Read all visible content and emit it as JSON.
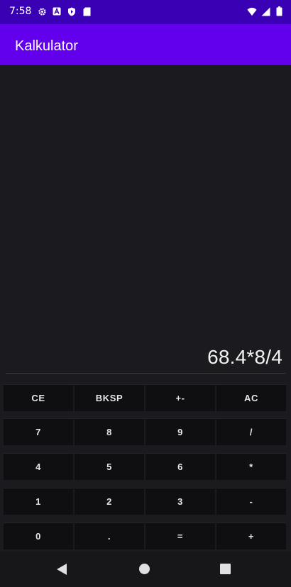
{
  "status_bar": {
    "time": "7:58",
    "left_icons": [
      "gear-icon",
      "font-icon",
      "shield-icon",
      "sd-card-icon"
    ],
    "right_icons": [
      "wifi-icon",
      "signal-icon",
      "battery-icon"
    ]
  },
  "app_bar": {
    "title": "Kalkulator"
  },
  "display": {
    "expression": "68.4*8/4"
  },
  "keypad": {
    "rows": [
      [
        "CE",
        "BKSP",
        "+-",
        "AC"
      ],
      [
        "7",
        "8",
        "9",
        "/"
      ],
      [
        "4",
        "5",
        "6",
        "*"
      ],
      [
        "1",
        "2",
        "3",
        "-"
      ],
      [
        "0",
        ".",
        "=",
        "+"
      ]
    ]
  },
  "nav_bar": {
    "buttons": [
      "back-icon",
      "home-icon",
      "recents-icon"
    ]
  },
  "colors": {
    "status_bar": "#3a00b3",
    "app_bar": "#6200ee",
    "background": "#1b1b1f",
    "key": "#0f0f12"
  }
}
